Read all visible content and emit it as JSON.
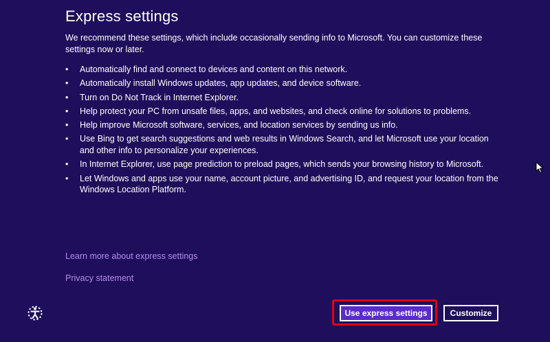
{
  "header": {
    "title": "Express settings"
  },
  "intro": {
    "text": "We recommend these settings, which include occasionally sending info to Microsoft. You can customize these settings now or later."
  },
  "settings": {
    "bullet": "•",
    "items": [
      "Automatically find and connect to devices and content on this network.",
      "Automatically install Windows updates, app updates, and device software.",
      "Turn on Do Not Track in Internet Explorer.",
      "Help protect your PC from unsafe files, apps, and websites, and check online for solutions to problems.",
      "Help improve Microsoft software, services, and location services by sending us info.",
      "Use Bing to get search suggestions and web results in Windows Search, and let Microsoft use your location and other info to personalize your experiences.",
      "In Internet Explorer, use page prediction to preload pages, which sends your browsing history to Microsoft.",
      "Let Windows and apps use your name, account picture, and advertising ID, and request your location from the Windows Location Platform."
    ]
  },
  "links": {
    "learn_more": "Learn more about express settings",
    "privacy": "Privacy statement"
  },
  "buttons": {
    "express": "Use express settings",
    "customize": "Customize"
  },
  "icons": {
    "ease_of_access": "ease-of-access-icon",
    "cursor": "mouse-pointer-icon"
  },
  "colors": {
    "background": "#1f0e5b",
    "link": "#b58bf0",
    "primary_button": "#5b2cc7",
    "highlight": "#e3000f"
  }
}
